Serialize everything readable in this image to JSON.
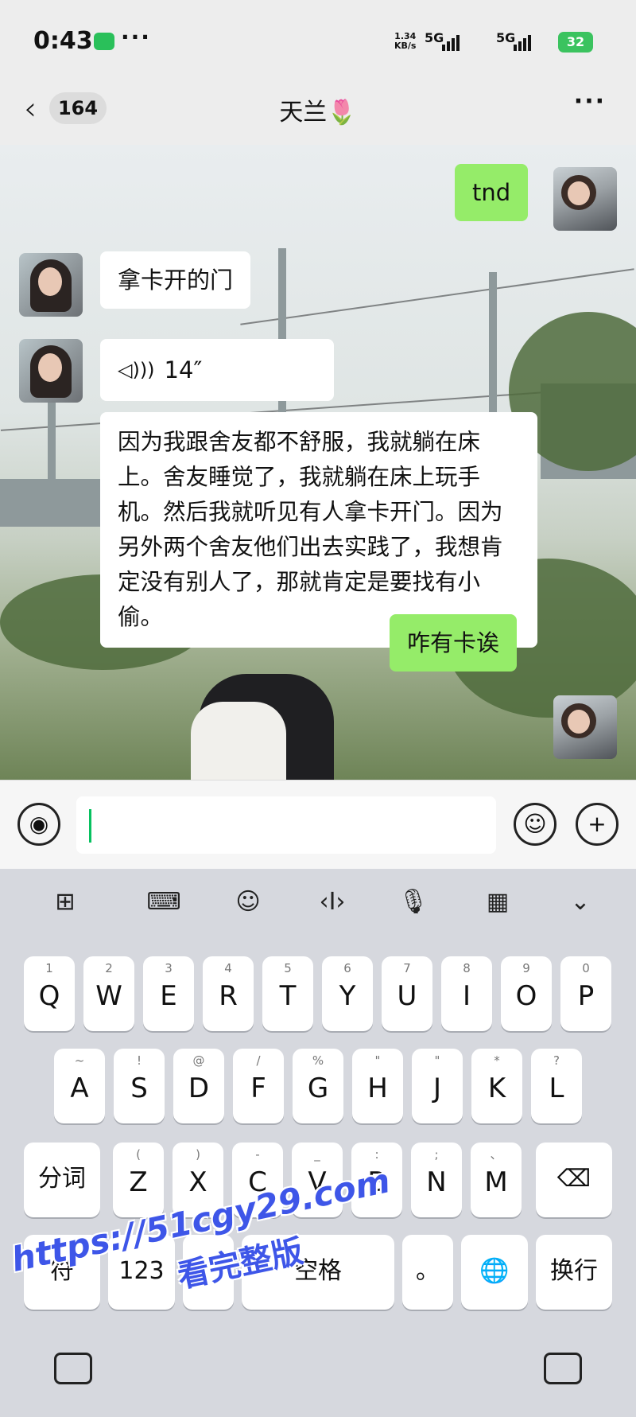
{
  "status_bar": {
    "time": "0:43",
    "overflow": "···",
    "net_speed_value": "1.34",
    "net_speed_unit": "KB/s",
    "signal1": "5G",
    "signal2": "5G",
    "battery": "32"
  },
  "nav": {
    "back_glyph": "‹",
    "unread_count": "164",
    "title": "天兰🌷",
    "more": "···"
  },
  "messages": [
    {
      "from": "self",
      "text": "tnd"
    },
    {
      "from": "other",
      "text": "拿卡开的门"
    },
    {
      "from": "other",
      "type": "voice",
      "duration": "14″"
    },
    {
      "from": "other",
      "text": "因为我跟舍友都不舒服，我就躺在床上。舍友睡觉了，我就躺在床上玩手机。然后我就听见有人拿卡开门。因为另外两个舍友他们出去实践了，我想肯定没有别人了，那就肯定是要找有小偷。"
    },
    {
      "from": "self",
      "text": "咋有卡诶"
    }
  ],
  "input": {
    "value": ""
  },
  "keyboard": {
    "toolbar": [
      "grid-icon",
      "keyboard-icon",
      "emoji-icon",
      "cursor-icon",
      "mic-icon",
      "clip-icon",
      "collapse-icon"
    ],
    "row1": [
      {
        "main": "Q",
        "hint": "1"
      },
      {
        "main": "W",
        "hint": "2"
      },
      {
        "main": "E",
        "hint": "3"
      },
      {
        "main": "R",
        "hint": "4"
      },
      {
        "main": "T",
        "hint": "5"
      },
      {
        "main": "Y",
        "hint": "6"
      },
      {
        "main": "U",
        "hint": "7"
      },
      {
        "main": "I",
        "hint": "8"
      },
      {
        "main": "O",
        "hint": "9"
      },
      {
        "main": "P",
        "hint": "0"
      }
    ],
    "row2": [
      {
        "main": "A",
        "hint": "~"
      },
      {
        "main": "S",
        "hint": "!"
      },
      {
        "main": "D",
        "hint": "@"
      },
      {
        "main": "F",
        "hint": "/"
      },
      {
        "main": "G",
        "hint": "%"
      },
      {
        "main": "H",
        "hint": "\""
      },
      {
        "main": "J",
        "hint": "\""
      },
      {
        "main": "K",
        "hint": "*"
      },
      {
        "main": "L",
        "hint": "?"
      }
    ],
    "row3": [
      {
        "main": "Z",
        "hint": "("
      },
      {
        "main": "X",
        "hint": ")"
      },
      {
        "main": "C",
        "hint": "-"
      },
      {
        "main": "V",
        "hint": "_"
      },
      {
        "main": "B",
        "hint": ":"
      },
      {
        "main": "N",
        "hint": ";"
      },
      {
        "main": "M",
        "hint": "、"
      }
    ],
    "fenci": "分词",
    "symbol": "符",
    "num": "123",
    "comma": "，",
    "space": "空格",
    "period": "。",
    "enter": "换行"
  },
  "watermark": {
    "url": "https://51cgy29.com",
    "sub": "看完整版"
  },
  "colors": {
    "outgoing_bubble": "#95ec69",
    "incoming_bubble": "#ffffff",
    "accent_caret": "#07c160",
    "watermark": "#3e56e8"
  }
}
